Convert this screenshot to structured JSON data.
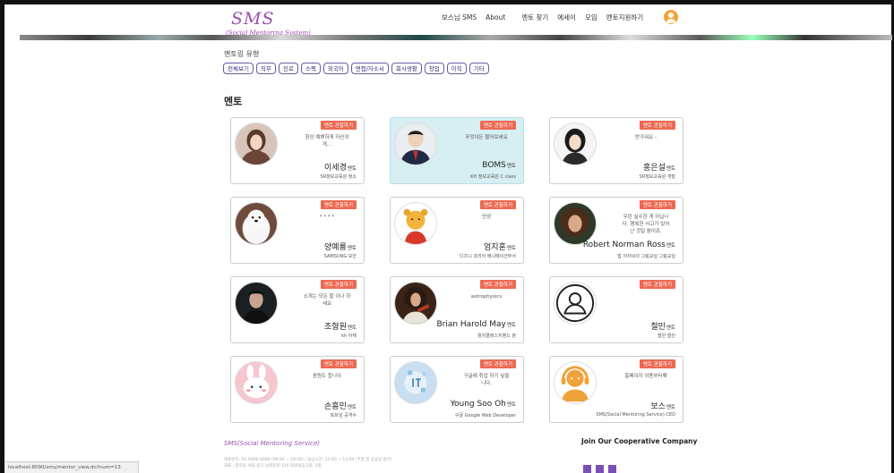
{
  "header": {
    "logo_title": "SMS",
    "logo_sub": "(Social Mentoring System)",
    "nav": [
      "보스님 SMS",
      "About",
      "멘토 찾기",
      "에세이",
      "모임",
      "멘토지원하기"
    ]
  },
  "mentoring_type": {
    "title": "멘토링 유형",
    "chips": [
      "전체보기",
      "직무",
      "진로",
      "스펙",
      "외국어",
      "면접/자소서",
      "회사생활",
      "창업",
      "이직",
      "기타"
    ]
  },
  "section_title": "멘토",
  "mentor_badge": "멘토 관찰하기",
  "mentor_suffix": "멘토",
  "mentors": [
    {
      "name": "이세경",
      "intro": "항상 예쁘하게 자신의 게...",
      "org": "SR정보교육원 정소"
    },
    {
      "name": "BOMS",
      "intro": "무엇이든 물어보세요",
      "org": "KH 정보교육원 C class"
    },
    {
      "name": "홍은설",
      "intro": "반가워요 -",
      "org": "SR정보교육원 개발"
    },
    {
      "name": "양예룡",
      "intro": "* * * *",
      "org": "SAMSUNG 보안"
    },
    {
      "name": "엄지훈",
      "intro": "안녕",
      "org": "디즈니 코리아 애니메이션부서"
    },
    {
      "name": "Robert Norman Ross",
      "intro": "우린 실수한 게 아닙니다. 행복한 사고가 있어난 것일 뿐이죠.",
      "org": "밥 아저씨의 그림교실 그림교실"
    },
    {
      "name": "조형원",
      "intro": "소개는 모든 할 이나 하세요",
      "org": "kh 아체"
    },
    {
      "name": "Brian Harold May",
      "intro": "astrophysics",
      "org": "월치클레스지벤드 퀸"
    },
    {
      "name": "철민",
      "intro": "",
      "org": "철민 철민"
    },
    {
      "name": "손흥민",
      "intro": "응원도 합니다",
      "org": "토트넘 공격수"
    },
    {
      "name": "Young Soo Oh",
      "intro": "구글에 취업 하기 싶을 니다.",
      "org": "구글 Google Web Developer"
    },
    {
      "name": "보스",
      "intro": "홈페이지 이용부터해",
      "org": "SMS(Social Mentoring Service) CEO"
    }
  ],
  "footer": {
    "brand": "SMS(Social Mentoring Service)",
    "line1": "대표번호: 02-0000-0000 (09:00 ~ 18:00) | 점심시간: 12:00 ~ 13:00 (주말 및 공휴일 휴무)",
    "line2": "대표 : 종로동 서울 중구 남대문로 120 대일빌딩 2층, 3층",
    "cooperative": "Join Our Cooperative Company"
  },
  "status_url": "localhost:8090/sms/mentor_view.do?num=13",
  "colors": {
    "brand": "#9a4fb0",
    "badge": "#ec6a52",
    "highlight": "#d7eef3",
    "chip_border": "#6a5aa6"
  }
}
